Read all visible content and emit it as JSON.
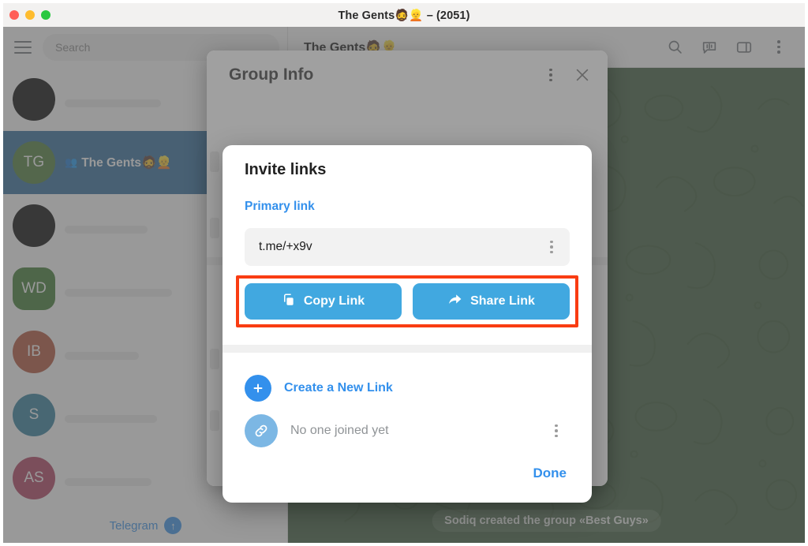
{
  "window": {
    "title": "The Gents🧔👱 – (2051)",
    "traffic_lights": [
      "close",
      "minimize",
      "maximize"
    ]
  },
  "sidebar": {
    "menu_icon": "hamburger-icon",
    "search": {
      "placeholder": "Search",
      "value": ""
    },
    "chats": [
      {
        "initials": "",
        "color": "#000000",
        "shape": "circle",
        "title": "",
        "selected": false
      },
      {
        "initials": "TG",
        "color": "#4a7c36",
        "shape": "circle",
        "title": "The Gents🧔👱",
        "selected": true,
        "group_icon": "group-people-icon"
      },
      {
        "initials": "",
        "color": "#000000",
        "shape": "circle",
        "title": "",
        "selected": false
      },
      {
        "initials": "WD",
        "color": "#3c7a2f",
        "shape": "squircle",
        "title": "",
        "selected": false
      },
      {
        "initials": "IB",
        "color": "#b44f36",
        "shape": "circle",
        "title": "",
        "selected": false
      },
      {
        "initials": "S",
        "color": "#2a7d9c",
        "shape": "circle",
        "title": "",
        "selected": false
      },
      {
        "initials": "AS",
        "color": "#b03b5d",
        "shape": "circle",
        "title": "",
        "selected": false
      }
    ],
    "footer": {
      "label": "Telegram",
      "badge": "↑"
    }
  },
  "chat": {
    "header_title": "The Gents🧔👱",
    "actions": [
      {
        "name": "search-icon",
        "label": "Search"
      },
      {
        "name": "transcribe-icon",
        "label": "Voice transcription"
      },
      {
        "name": "sidebar-panel-icon",
        "label": "Toggle panel"
      },
      {
        "name": "more-icon",
        "label": "More"
      }
    ],
    "service_message": "Sodiq created the group «Best Guys»"
  },
  "group_info": {
    "title": "Group Info",
    "more_icon": "kebab-menu-icon",
    "close_icon": "close-icon"
  },
  "invite_links": {
    "title": "Invite links",
    "primary_label": "Primary link",
    "link": {
      "value": "t.me/+x9v",
      "menu_icon": "kebab-menu-icon"
    },
    "buttons": {
      "copy": {
        "label": "Copy Link",
        "icon": "copy-icon"
      },
      "share": {
        "label": "Share Link",
        "icon": "share-arrow-icon"
      }
    },
    "create_new": {
      "label": "Create a New Link",
      "icon": "plus-circle-icon"
    },
    "link_item": {
      "status": "No one joined yet",
      "icon": "chain-link-icon",
      "menu_icon": "kebab-menu-icon"
    },
    "done": "Done"
  },
  "colors": {
    "accent": "#3390ec",
    "button_blue": "#41a8e0",
    "highlight_red": "#f93c12",
    "selected_chat": "#2b6a9b",
    "wallpaper": "#3b5b3b"
  }
}
